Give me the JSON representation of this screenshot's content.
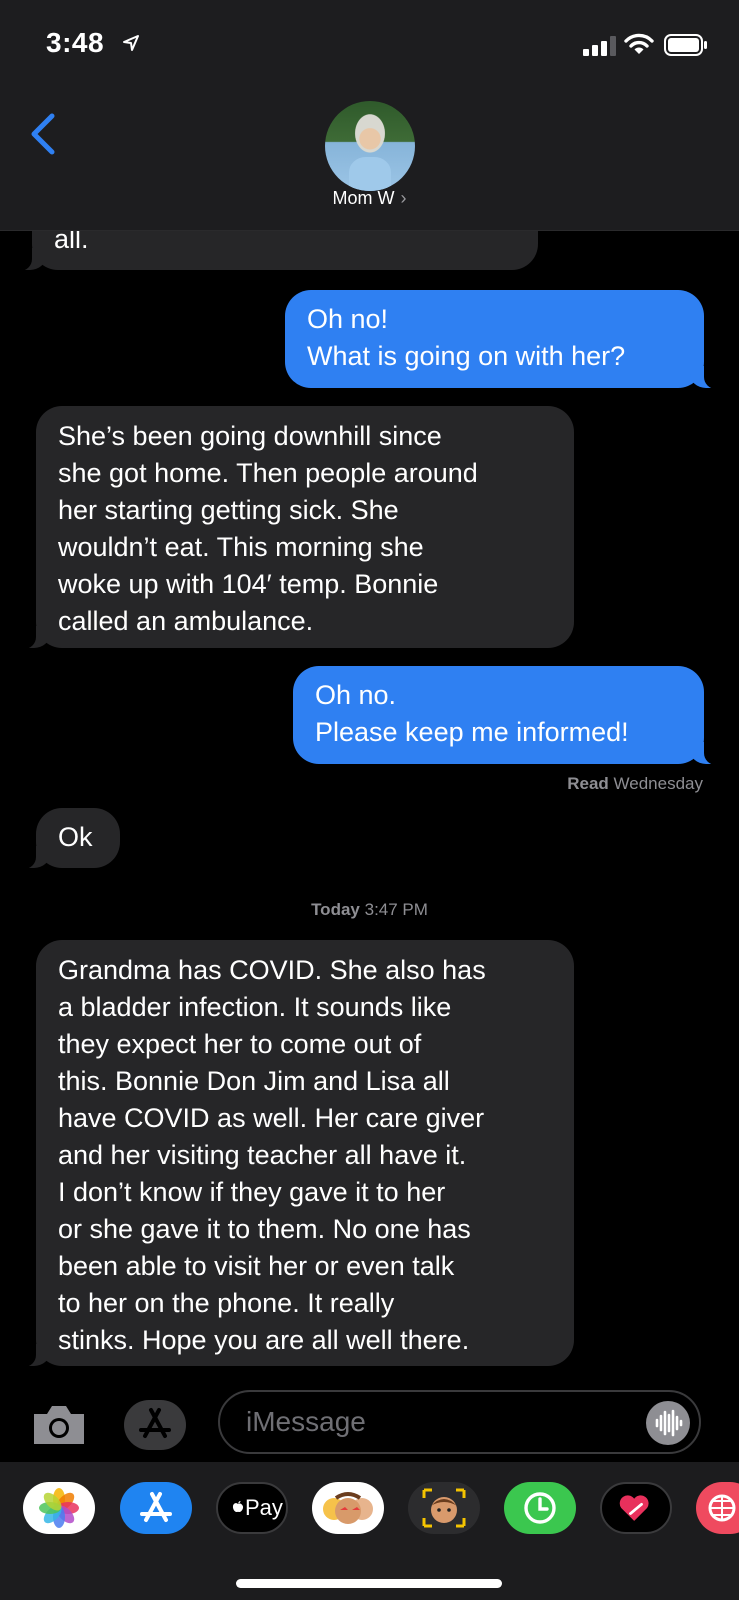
{
  "status_bar": {
    "time": "3:48"
  },
  "conversation": {
    "contact_name": "Mom W",
    "messages": [
      {
        "from": "them",
        "lines": [
          "all."
        ]
      },
      {
        "from": "me",
        "lines": [
          "Oh no!",
          "What is going on with her?"
        ]
      },
      {
        "from": "them",
        "lines": [
          "She’s been going downhill since",
          "she got home. Then people around",
          "her starting getting sick. She",
          "wouldn’t eat. This morning she",
          "woke up with 104′ temp. Bonnie",
          "called an ambulance."
        ]
      },
      {
        "from": "me",
        "lines": [
          "Oh no.",
          "Please keep me informed!"
        ]
      },
      {
        "from": "them",
        "lines": [
          "Ok"
        ]
      },
      {
        "from": "them",
        "lines": [
          "Grandma has COVID. She also has",
          "a bladder infection. It sounds like",
          "they expect her to come out of",
          "this. Bonnie Don Jim and Lisa all",
          "have COVID as well. Her care giver",
          "and her visiting teacher all have it.",
          "I don’t know if they gave it to her",
          "or she gave it to them. No one has",
          "been able to visit her or even talk",
          "to her on the phone. It really",
          "stinks. Hope you are all well there."
        ]
      }
    ],
    "read_receipt": {
      "label": "Read",
      "when": "Wednesday"
    },
    "timestamp": {
      "day": "Today",
      "time": "3:47 PM"
    }
  },
  "compose": {
    "placeholder": "iMessage"
  },
  "app_drawer": [
    {
      "name": "photos",
      "icon": "photos-icon"
    },
    {
      "name": "app-store",
      "icon": "app-store-icon"
    },
    {
      "name": "apple-pay",
      "icon": "apple-pay-icon",
      "label": "Pay"
    },
    {
      "name": "memoji-stickers",
      "icon": "memoji-stickers-icon"
    },
    {
      "name": "animoji",
      "icon": "animoji-icon"
    },
    {
      "name": "screen-time",
      "icon": "clock-icon"
    },
    {
      "name": "digital-touch",
      "icon": "heart-touch-icon"
    },
    {
      "name": "search-web",
      "icon": "globe-icon"
    }
  ],
  "colors": {
    "sent_bubble": "#2f80f2",
    "received_bubble": "#262628",
    "header_bg": "#1d1d1f",
    "back_chevron": "#2f80f2"
  }
}
